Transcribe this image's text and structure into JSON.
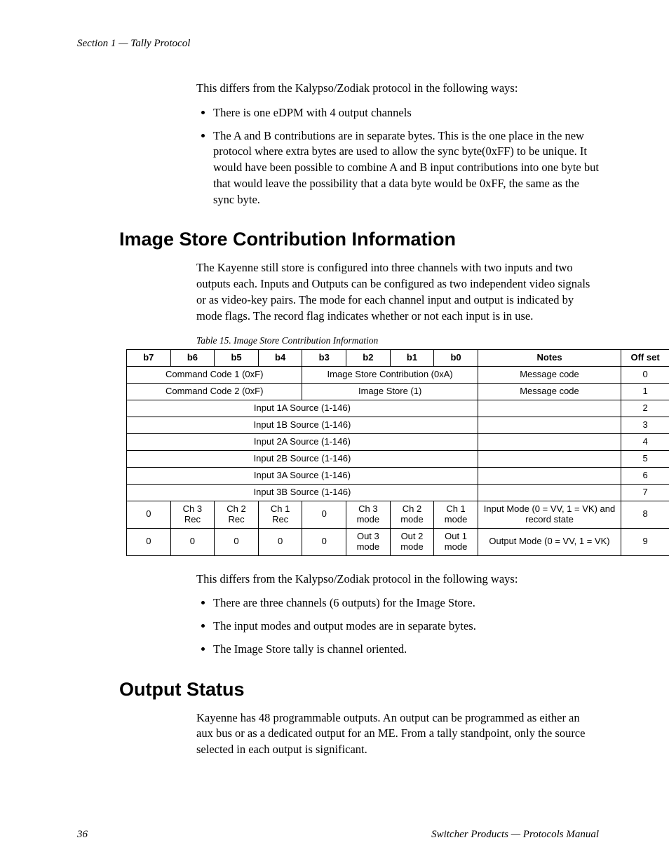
{
  "header": {
    "section_label": "Section 1 — Tally Protocol"
  },
  "intro": {
    "para1": "This differs from the Kalypso/Zodiak protocol in the following ways:",
    "bullets": [
      "There is one eDPM with 4 output channels",
      "The A and B contributions are in separate bytes. This is the one place in the new protocol where extra bytes are used to allow the sync byte(0xFF) to be unique. It would have been possible to combine A and B input contributions into one byte but that would leave the possibility that a data byte would be 0xFF, the same as the sync byte."
    ]
  },
  "section1": {
    "heading": "Image Store Contribution Information",
    "para": "The Kayenne still store is configured into three channels with two inputs and two outputs each. Inputs and Outputs can be configured as two independent video signals or as video-key pairs. The mode for each channel input and output is indicated by mode flags. The record flag indicates whether or not each input is in use.",
    "table_caption": "Table 15.  Image Store Contribution Information",
    "table": {
      "head": [
        "b7",
        "b6",
        "b5",
        "b4",
        "b3",
        "b2",
        "b1",
        "b0",
        "Notes",
        "Off set"
      ],
      "r0": {
        "c1": "Command Code 1 (0xF)",
        "c2": "Image Store Contribution (0xA)",
        "notes": "Message code",
        "off": "0"
      },
      "r1": {
        "c1": "Command Code 2 (0xF)",
        "c2": "Image Store (1)",
        "notes": "Message code",
        "off": "1"
      },
      "r2": {
        "span": "Input 1A Source (1-146)",
        "notes": "",
        "off": "2"
      },
      "r3": {
        "span": "Input 1B Source (1-146)",
        "notes": "",
        "off": "3"
      },
      "r4": {
        "span": "Input 2A Source (1-146)",
        "notes": "",
        "off": "4"
      },
      "r5": {
        "span": "Input 2B Source (1-146)",
        "notes": "",
        "off": "5"
      },
      "r6": {
        "span": "Input 3A Source (1-146)",
        "notes": "",
        "off": "6"
      },
      "r7": {
        "span": "Input 3B Source (1-146)",
        "notes": "",
        "off": "7"
      },
      "r8": {
        "b7": "0",
        "b6": "Ch 3 Rec",
        "b5": "Ch 2 Rec",
        "b4": "Ch 1 Rec",
        "b3": "0",
        "b2": "Ch 3 mode",
        "b1": "Ch 2 mode",
        "b0": "Ch 1 mode",
        "notes": "Input Mode (0 = VV, 1 = VK) and record state",
        "off": "8"
      },
      "r9": {
        "b7": "0",
        "b6": "0",
        "b5": "0",
        "b4": "0",
        "b3": "0",
        "b2": "Out 3 mode",
        "b1": "Out 2 mode",
        "b0": "Out 1 mode",
        "notes": "Output Mode (0 = VV, 1 = VK)",
        "off": "9"
      }
    },
    "after_para": "This differs from the Kalypso/Zodiak protocol in the following ways:",
    "after_bullets": [
      "There are three channels (6 outputs) for the Image Store.",
      "The input modes and output modes are in separate bytes.",
      "The Image Store tally is channel oriented."
    ]
  },
  "section2": {
    "heading": "Output Status",
    "para": "Kayenne has 48 programmable outputs. An output can be programmed as either an aux bus or as a dedicated output for an ME. From a tally standpoint, only the source selected in each output is significant."
  },
  "footer": {
    "page": "36",
    "title": "Switcher Products  —  Protocols Manual"
  }
}
